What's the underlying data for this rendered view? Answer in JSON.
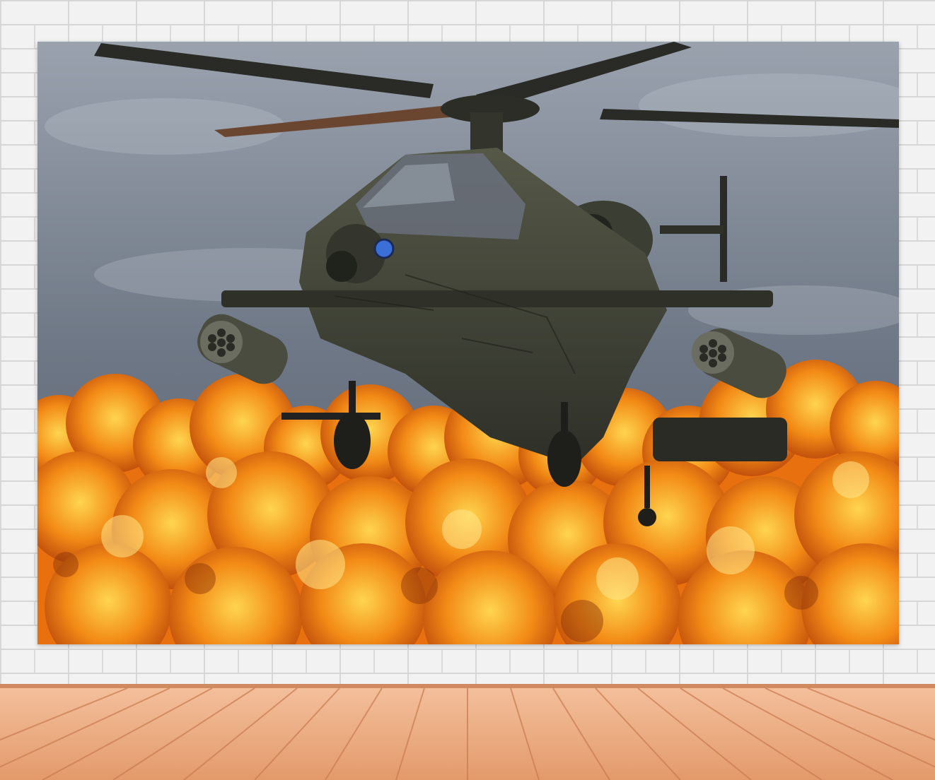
{
  "scene": {
    "description_free": true,
    "colors": {
      "wall": "#f2f2f2",
      "mortar": "#d6d6d6",
      "sky_top": "#8f98a6",
      "sky_bottom": "#5d6775",
      "helicopter_body": "#3d4033",
      "helicopter_dark": "#24261f",
      "fire_orange": "#f07d14",
      "fire_yellow": "#ffd34a",
      "fire_dark": "#b0400a",
      "floor_light": "#f2b38d",
      "floor_dark": "#d9865a",
      "sensor_blue": "#3a6fd8"
    }
  }
}
